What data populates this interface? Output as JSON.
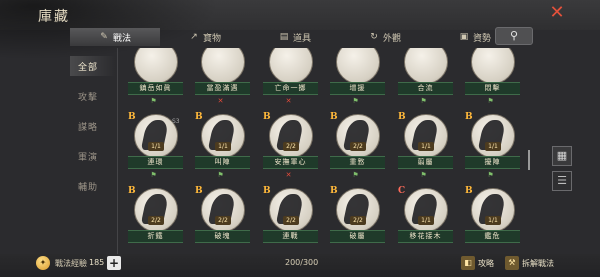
{
  "header": {
    "title": "庫藏",
    "close_glyph": "✕"
  },
  "tabs": [
    {
      "label": "戰法",
      "icon": "scroll-icon",
      "glyph": "✎",
      "active": true
    },
    {
      "label": "寶物",
      "icon": "chart-icon",
      "glyph": "↗",
      "active": false
    },
    {
      "label": "道具",
      "icon": "bag-icon",
      "glyph": "▤",
      "active": false
    },
    {
      "label": "外觀",
      "icon": "swirl-icon",
      "glyph": "↻",
      "active": false
    },
    {
      "label": "資勢",
      "icon": "box-icon",
      "glyph": "▣",
      "active": false
    }
  ],
  "search": {
    "glyph": "⚲"
  },
  "left_nav": [
    {
      "label": "全部",
      "active": true
    },
    {
      "label": "攻擊",
      "active": false
    },
    {
      "label": "謀略",
      "active": false
    },
    {
      "label": "軍演",
      "active": false
    },
    {
      "label": "輔助",
      "active": false
    }
  ],
  "cards": [
    {
      "name": "鎮岳如眞",
      "grade": "",
      "level": "",
      "status": "ok"
    },
    {
      "name": "當盈滿遇",
      "grade": "",
      "level": "",
      "status": "no"
    },
    {
      "name": "亡命一擲",
      "grade": "",
      "level": "",
      "status": "no"
    },
    {
      "name": "增援",
      "grade": "",
      "level": "",
      "status": "ok"
    },
    {
      "name": "合流",
      "grade": "",
      "level": "",
      "status": "ok"
    },
    {
      "name": "悶擊",
      "grade": "",
      "level": "",
      "status": "ok"
    },
    {
      "name": "連環",
      "grade": "B",
      "level": "1/1",
      "status": "ok",
      "badge": "S3"
    },
    {
      "name": "叫陣",
      "grade": "B",
      "level": "1/1",
      "status": "ok"
    },
    {
      "name": "安撫軍心",
      "grade": "B",
      "level": "2/2",
      "status": "no"
    },
    {
      "name": "重憝",
      "grade": "B",
      "level": "2/2",
      "status": "ok"
    },
    {
      "name": "翦屬",
      "grade": "B",
      "level": "1/1",
      "status": "ok"
    },
    {
      "name": "擾陣",
      "grade": "B",
      "level": "1/1",
      "status": "ok"
    },
    {
      "name": "折鐵",
      "grade": "B",
      "level": "2/2",
      "status": "ok"
    },
    {
      "name": "破塊",
      "grade": "B",
      "level": "2/2",
      "status": "ok"
    },
    {
      "name": "連戰",
      "grade": "B",
      "level": "2/2",
      "status": "ok"
    },
    {
      "name": "破屬",
      "grade": "B",
      "level": "2/2",
      "status": "ok"
    },
    {
      "name": "移花接木",
      "grade": "C",
      "level": "1/1",
      "status": "ok"
    },
    {
      "name": "鑑危",
      "grade": "B",
      "level": "1/1",
      "status": "ok"
    }
  ],
  "bottom": {
    "exp_label": "戰法經驗",
    "exp_value": "185",
    "count": "200/300",
    "btn_attack": "攻略",
    "btn_disassemble": "拆解戰法"
  }
}
